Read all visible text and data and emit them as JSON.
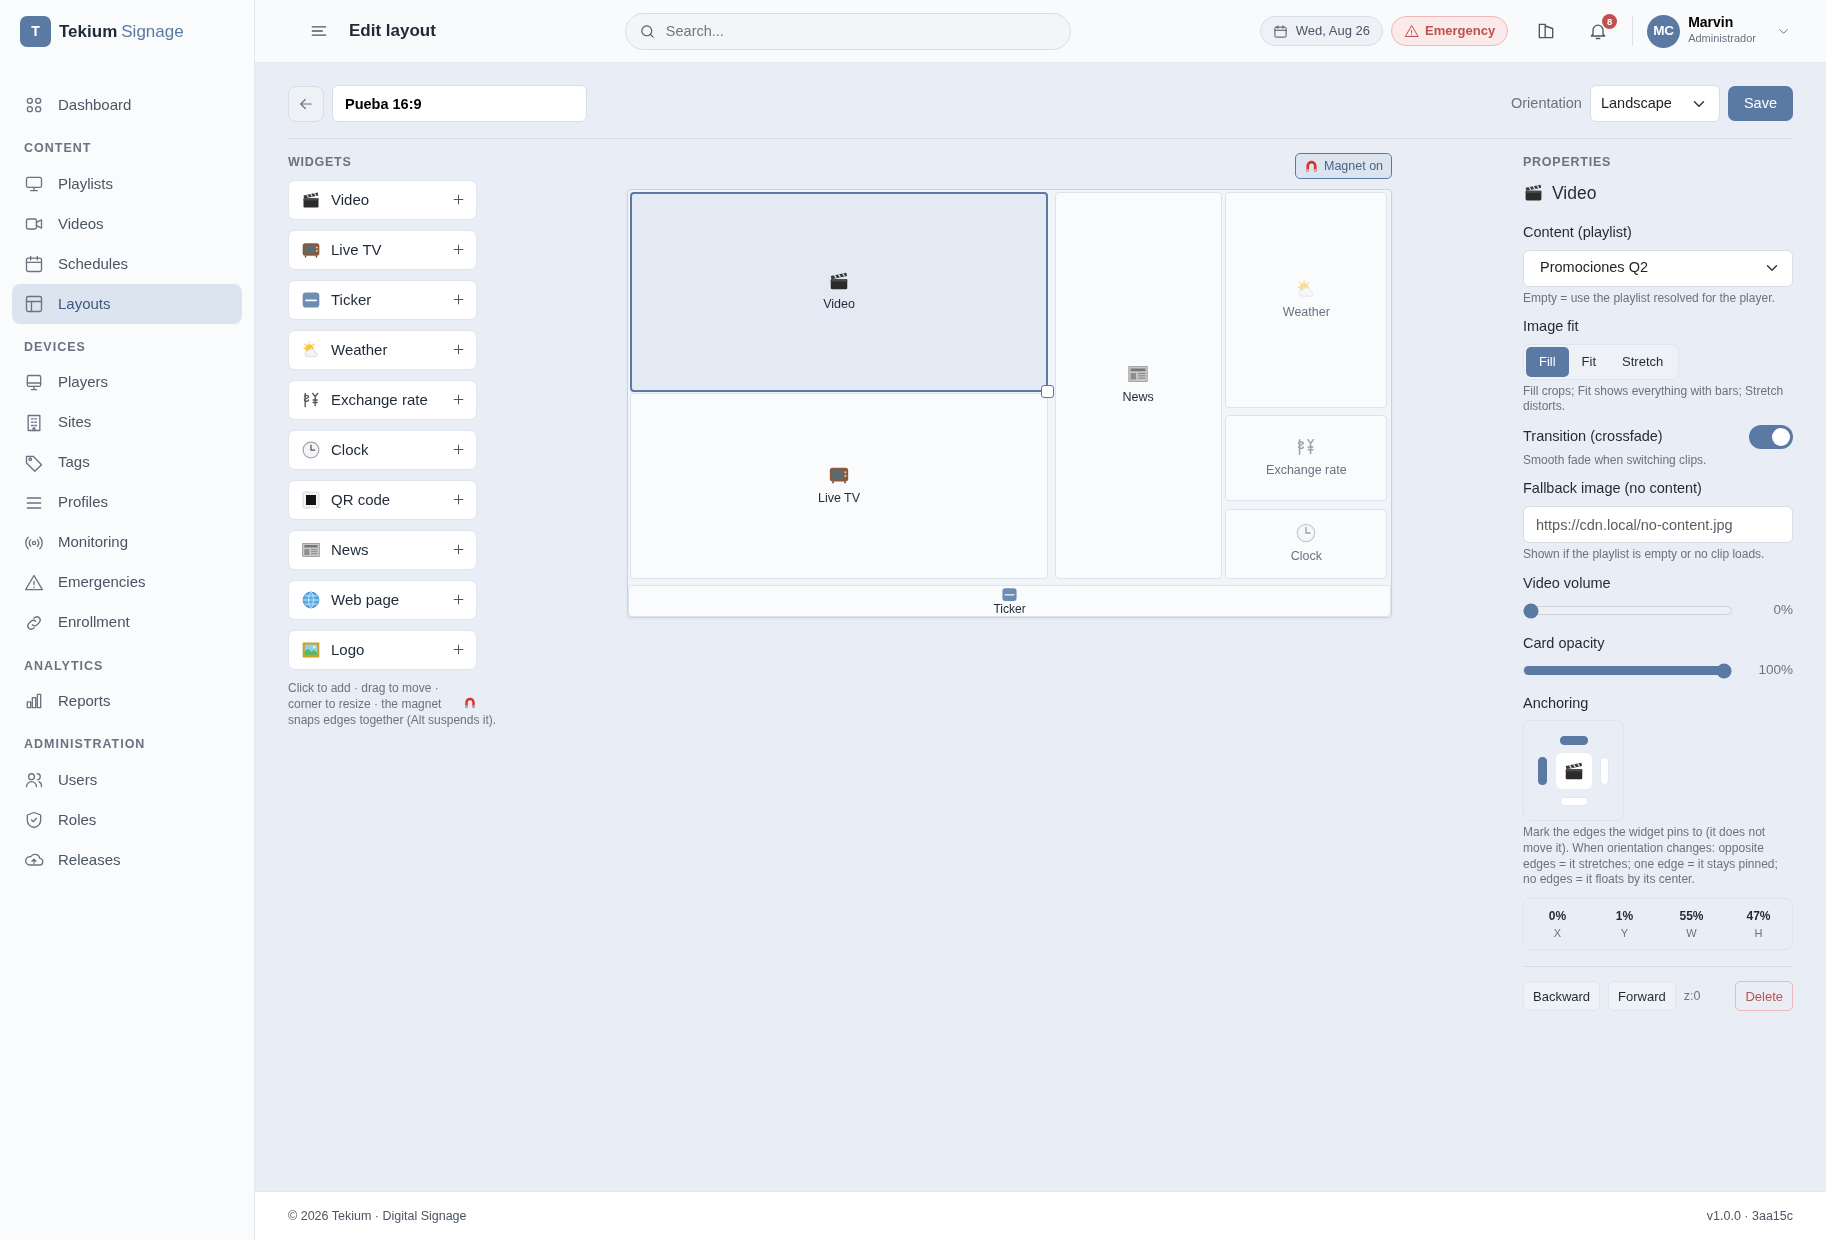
{
  "sidebar": {
    "brand": {
      "initial": "T",
      "name": "Tekium",
      "accent": "Signage"
    },
    "sections": [
      {
        "items": [
          {
            "label": "Dashboard",
            "selected": false
          }
        ]
      },
      {
        "heading": "CONTENT",
        "items": [
          {
            "label": "Playlists",
            "selected": false
          },
          {
            "label": "Videos",
            "selected": false
          },
          {
            "label": "Schedules",
            "selected": false
          },
          {
            "label": "Layouts",
            "selected": true
          }
        ]
      },
      {
        "heading": "DEVICES",
        "items": [
          {
            "label": "Players",
            "selected": false
          },
          {
            "label": "Sites",
            "selected": false
          },
          {
            "label": "Tags",
            "selected": false
          },
          {
            "label": "Profiles",
            "selected": false
          },
          {
            "label": "Monitoring",
            "selected": false
          },
          {
            "label": "Emergencies",
            "selected": false
          },
          {
            "label": "Enrollment",
            "selected": false
          }
        ]
      },
      {
        "heading": "ANALYTICS",
        "items": [
          {
            "label": "Reports",
            "selected": false
          }
        ]
      },
      {
        "heading": "ADMINISTRATION",
        "items": [
          {
            "label": "Users",
            "selected": false
          },
          {
            "label": "Roles",
            "selected": false
          },
          {
            "label": "Releases",
            "selected": false
          }
        ]
      }
    ]
  },
  "topbar": {
    "title": "Edit layout",
    "search": {
      "placeholder": "Search..."
    },
    "date": "Wed, Aug 26",
    "emergency": "Emergency",
    "notifications": "8",
    "user": {
      "initials": "MC",
      "name": "Marvin",
      "role": "Administrador"
    }
  },
  "toolbar": {
    "layout_name": "Pueba 16:9",
    "orientation_label": "Orientation",
    "orientation": "Landscape",
    "save": "Save"
  },
  "widgets": {
    "heading": "WIDGETS",
    "items": [
      {
        "kind": "video",
        "label": "Video"
      },
      {
        "kind": "live_tv",
        "label": "Live TV"
      },
      {
        "kind": "ticker",
        "label": "Ticker"
      },
      {
        "kind": "weather",
        "label": "Weather"
      },
      {
        "kind": "exchange",
        "label": "Exchange rate"
      },
      {
        "kind": "clock",
        "label": "Clock"
      },
      {
        "kind": "qr",
        "label": "QR code"
      },
      {
        "kind": "news",
        "label": "News"
      },
      {
        "kind": "web",
        "label": "Web page"
      },
      {
        "kind": "logo",
        "label": "Logo"
      }
    ],
    "hint_before": "Click to add · drag to move · corner to resize · the magnet",
    "hint_after": "snaps edges together (Alt suspends it)."
  },
  "canvas": {
    "magnet": {
      "label": "Magnet on",
      "on": true
    },
    "zones": [
      {
        "kind": "video",
        "label": "Video",
        "selected": true,
        "faded": false
      },
      {
        "kind": "live_tv",
        "label": "Live TV",
        "selected": false,
        "faded": false
      },
      {
        "kind": "news",
        "label": "News",
        "selected": false,
        "faded": false
      },
      {
        "kind": "weather",
        "label": "Weather",
        "selected": false,
        "faded": true
      },
      {
        "kind": "exchange",
        "label": "Exchange rate",
        "selected": false,
        "faded": true
      },
      {
        "kind": "clock",
        "label": "Clock",
        "selected": false,
        "faded": true
      },
      {
        "kind": "ticker",
        "label": "Ticker",
        "selected": false,
        "faded": false
      }
    ]
  },
  "properties": {
    "heading": "PROPERTIES",
    "widget": {
      "kind": "video",
      "name": "Video"
    },
    "content": {
      "label": "Content (playlist)",
      "value": "Promociones Q2",
      "help": "Empty = use the playlist resolved for the player."
    },
    "image_fit": {
      "label": "Image fit",
      "options": [
        {
          "label": "Fill",
          "selected": true
        },
        {
          "label": "Fit",
          "selected": false
        },
        {
          "label": "Stretch",
          "selected": false
        }
      ],
      "help": "Fill crops; Fit shows everything with bars; Stretch distorts."
    },
    "transition": {
      "label": "Transition (crossfade)",
      "on": true,
      "help": "Smooth fade when switching clips."
    },
    "fallback": {
      "label": "Fallback image (no content)",
      "placeholder": "https://cdn.local/no-content.jpg",
      "help": "Shown if the playlist is empty or no clip loads."
    },
    "sliders": [
      {
        "label": "Video volume",
        "level": 0,
        "reading": "0%"
      },
      {
        "label": "Card opacity",
        "level": 1,
        "reading": "100%"
      }
    ],
    "anchoring": {
      "label": "Anchoring",
      "top": true,
      "left": true,
      "right": false,
      "bottom": false,
      "help": "Mark the edges the widget pins to (it does not move it). When orientation changes: opposite edges = it stretches; one edge = it stays pinned; no edges = it floats by its center."
    },
    "geometry": [
      {
        "value": "0%",
        "axis": "X"
      },
      {
        "value": "1%",
        "axis": "Y"
      },
      {
        "value": "55%",
        "axis": "W"
      },
      {
        "value": "47%",
        "axis": "H"
      }
    ],
    "actions": {
      "backward": "Backward",
      "forward": "Forward",
      "z_index": "z:0",
      "delete": "Delete"
    }
  },
  "footer": {
    "copyright": "© 2026 Tekium · Digital Signage",
    "version": "v1.0.0 · 3aa15c"
  }
}
